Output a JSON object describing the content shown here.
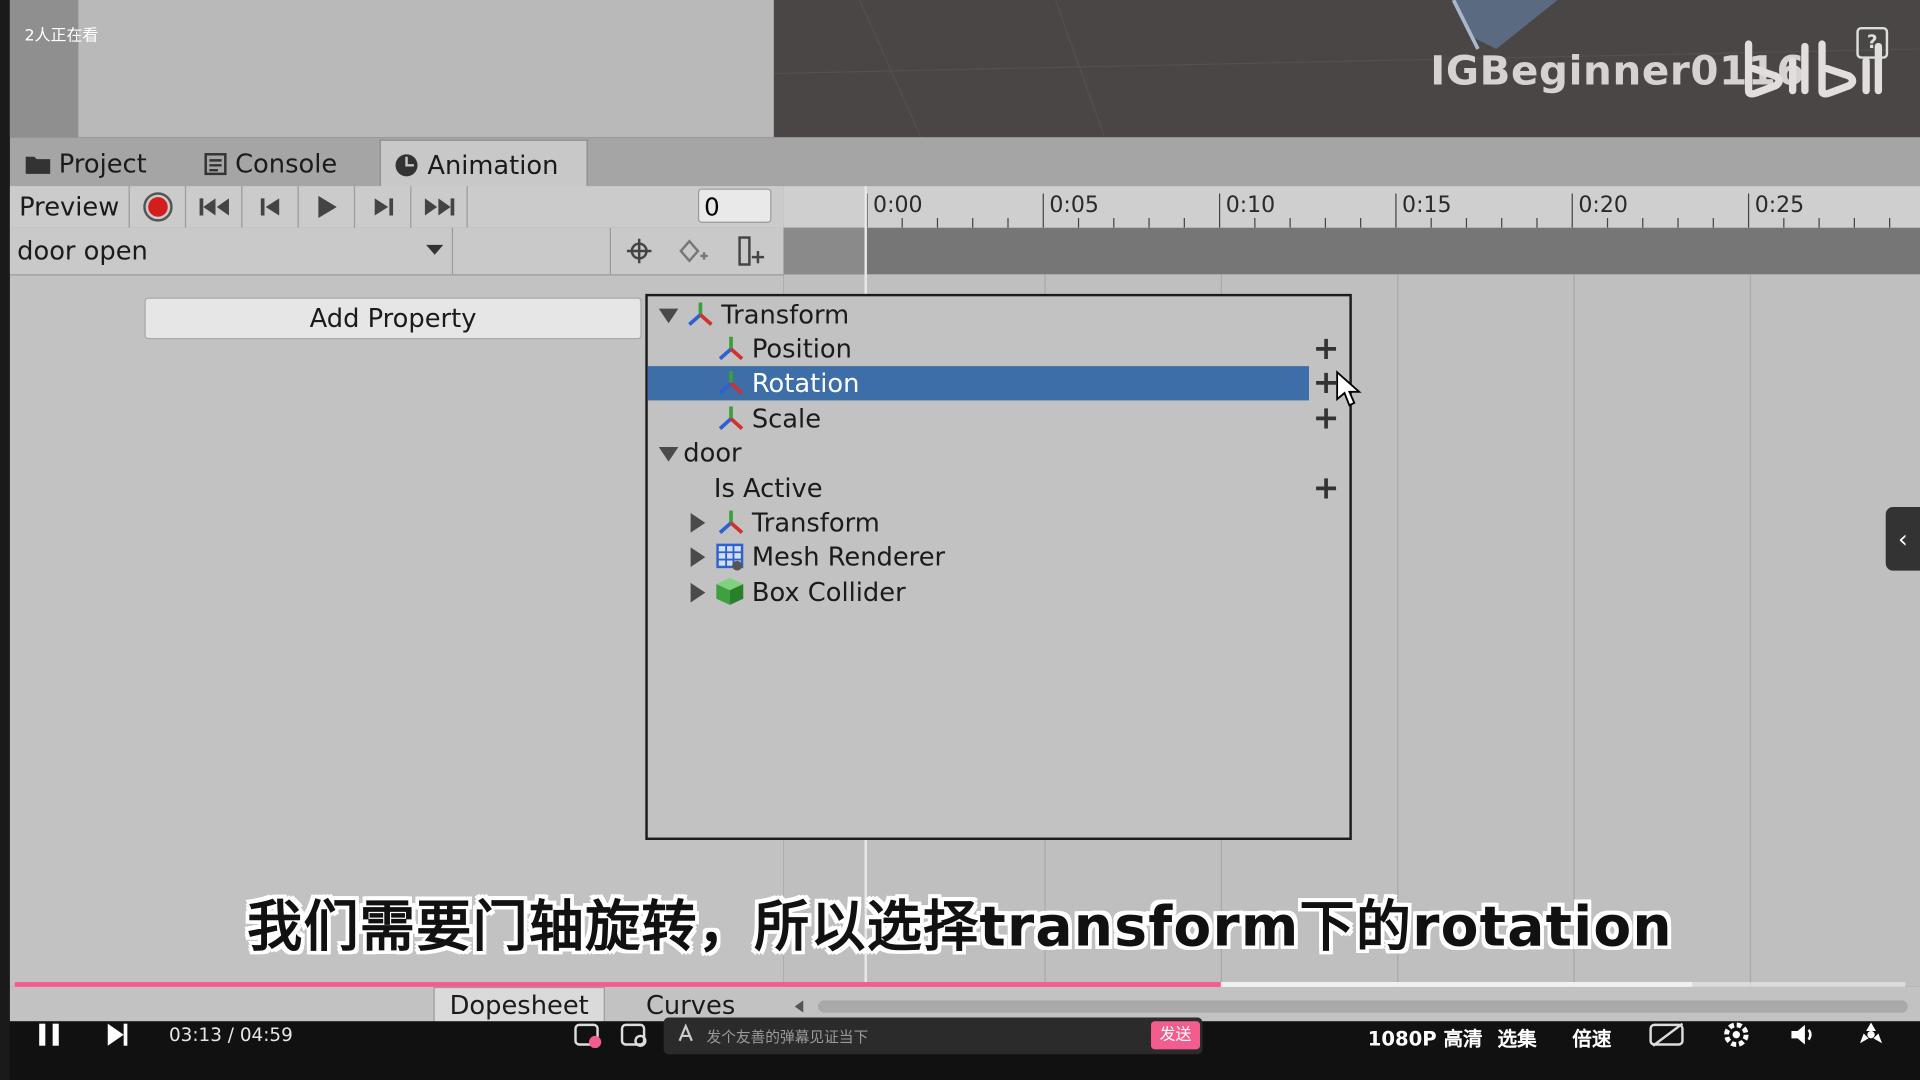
{
  "overlay": {
    "viewers": "2人正在看",
    "channel_watermark": "IGBeginner0116",
    "help_label": "?"
  },
  "unity": {
    "tabs": [
      {
        "label": "Project",
        "icon": "folder-icon"
      },
      {
        "label": "Console",
        "icon": "console-icon"
      },
      {
        "label": "Animation",
        "icon": "clock-icon",
        "active": true
      }
    ],
    "toolbar": {
      "preview_label": "Preview",
      "frame_value": "0"
    },
    "clip_name": "door open",
    "add_property_label": "Add Property",
    "timeline_ticks": [
      "0:00",
      "0:05",
      "0:10",
      "0:15",
      "0:20",
      "0:25"
    ],
    "property_popup": {
      "items": [
        {
          "label": "Transform",
          "level": 0,
          "expanded": true,
          "icon": "transform-axes-icon"
        },
        {
          "label": "Position",
          "level": 1,
          "icon": "transform-axes-icon",
          "addable": true
        },
        {
          "label": "Rotation",
          "level": 1,
          "icon": "transform-axes-icon",
          "addable": true,
          "selected": true
        },
        {
          "label": "Scale",
          "level": 1,
          "icon": "transform-axes-icon",
          "addable": true
        },
        {
          "label": "door",
          "level": 0,
          "expanded": true
        },
        {
          "label": "Is Active",
          "level": 1,
          "addable": true
        },
        {
          "label": "Transform",
          "level": 1,
          "collapsed": true,
          "icon": "transform-axes-icon"
        },
        {
          "label": "Mesh Renderer",
          "level": 1,
          "collapsed": true,
          "icon": "mesh-renderer-icon"
        },
        {
          "label": "Box Collider",
          "level": 1,
          "collapsed": true,
          "icon": "box-collider-icon"
        }
      ]
    },
    "bottom_tabs": [
      "Dopesheet",
      "Curves"
    ]
  },
  "subtitle": "我们需要门轴旋转，所以选择transform下的rotation",
  "player": {
    "current_time": "03:13",
    "separator": "/",
    "total_time": "04:59",
    "progress": 0.638,
    "danmaku_placeholder": "发个友善的弹幕见证当下",
    "send_label": "发送",
    "quality_label": "1080P 高清",
    "episodes_label": "选集",
    "speed_label": "倍速",
    "colors": {
      "accent": "#f25d8e",
      "selection": "#3d6ea8"
    }
  }
}
